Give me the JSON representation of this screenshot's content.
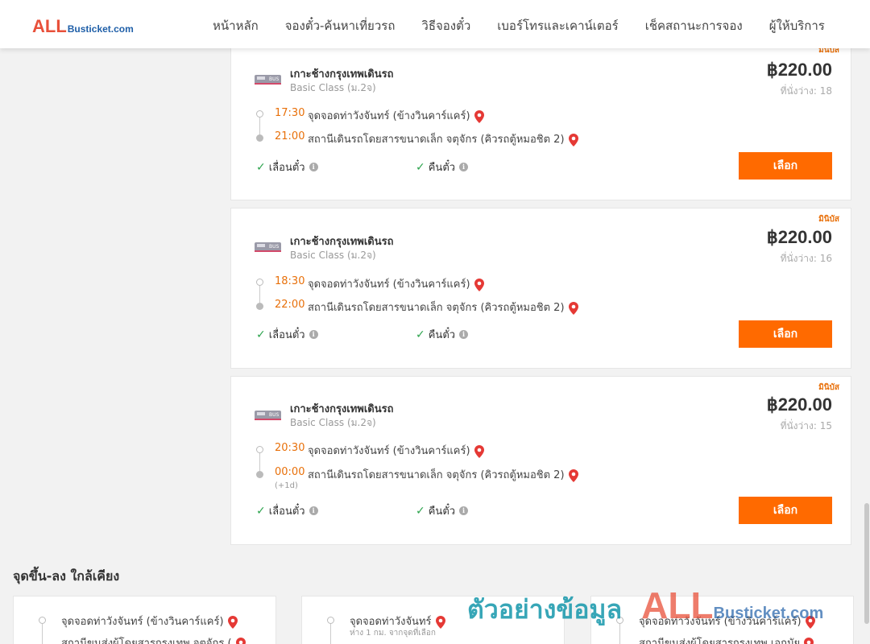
{
  "brand": {
    "logo_all": "ALL",
    "logo_rest": "Busticket.com"
  },
  "nav": [
    {
      "label": "หน้าหลัก"
    },
    {
      "label": "จองตั๋ว-ค้นหาเที่ยวรถ"
    },
    {
      "label": "วิธีจองตั๋ว"
    },
    {
      "label": "เบอร์โทรและเคาน์เตอร์"
    },
    {
      "label": "เช็คสถานะการจอง"
    },
    {
      "label": "ผู้ให้บริการ"
    }
  ],
  "trips": [
    {
      "badge": "มินิบัส",
      "operator": "เกาะช้างกรุงเทพเดินรถ",
      "class": "Basic Class (ม.2จ)",
      "price": "฿220.00",
      "seats": "ที่นั่งว่าง: 18",
      "depart_time": "17:30",
      "depart_stop": "จุดจอดท่าวังจันทร์ (ข้างวินคาร์แคร์)",
      "arrive_time": "21:00",
      "arrive_stop": "สถานีเดินรถโดยสารขนาดเล็ก จตุจักร (คิวรถตู้หมอชิต 2)",
      "plus_day": "",
      "feature1": "เลื่อนตั๋ว",
      "feature2": "คืนตั๋ว",
      "button": "เลือก"
    },
    {
      "badge": "มินิบัส",
      "operator": "เกาะช้างกรุงเทพเดินรถ",
      "class": "Basic Class (ม.2จ)",
      "price": "฿220.00",
      "seats": "ที่นั่งว่าง: 16",
      "depart_time": "18:30",
      "depart_stop": "จุดจอดท่าวังจันทร์ (ข้างวินคาร์แคร์)",
      "arrive_time": "22:00",
      "arrive_stop": "สถานีเดินรถโดยสารขนาดเล็ก จตุจักร (คิวรถตู้หมอชิต 2)",
      "plus_day": "",
      "feature1": "เลื่อนตั๋ว",
      "feature2": "คืนตั๋ว",
      "button": "เลือก"
    },
    {
      "badge": "มินิบัส",
      "operator": "เกาะช้างกรุงเทพเดินรถ",
      "class": "Basic Class (ม.2จ)",
      "price": "฿220.00",
      "seats": "ที่นั่งว่าง: 15",
      "depart_time": "20:30",
      "depart_stop": "จุดจอดท่าวังจันทร์ (ข้างวินคาร์แคร์)",
      "arrive_time": "00:00",
      "arrive_stop": "สถานีเดินรถโดยสารขนาดเล็ก จตุจักร (คิวรถตู้หมอชิต 2)",
      "plus_day": "(+1d)",
      "feature1": "เลื่อนตั๋ว",
      "feature2": "คืนตั๋ว",
      "button": "เลือก"
    }
  ],
  "nearby": {
    "title": "จุดขึ้น-ลง ใกล้เคียง",
    "cards": [
      {
        "from": "จุดจอดท่าวังจันทร์ (ข้างวินคาร์แคร์)",
        "note": "",
        "to": "สถานีขนส่งผู้โดยสารกรุงเทพ จตุจักร ("
      },
      {
        "from": "จุดจอดท่าวังจันทร์",
        "note": "ห่าง 1 กม. จากจุดที่เลือก",
        "to": ""
      },
      {
        "from": "จุดจอดท่าวังจันทร์ (ข้างวินคาร์แคร์)",
        "note": "",
        "to": "สถานีขนส่งผู้โดยสารกรุงเทพ เอกมัย"
      }
    ]
  },
  "watermark": {
    "text": "ตัวอย่างข้อมูล",
    "all": "ALL",
    "rest": "Busticket.com"
  },
  "colors": {
    "accent": "#ff6a00",
    "time": "#e8700a",
    "logo_red": "#e8503a",
    "logo_blue": "#1f5fa8",
    "check": "#2da44e",
    "pin": "#e53935"
  }
}
